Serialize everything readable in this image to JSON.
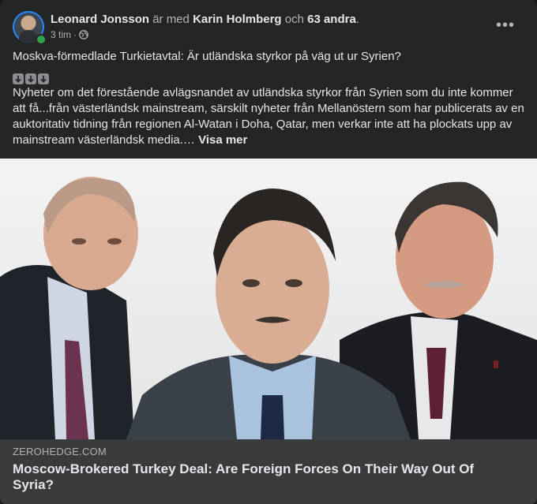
{
  "post": {
    "author": "Leonard Jonsson",
    "with_text": "är med",
    "tagged": "Karin Holmberg",
    "and_text": "och",
    "others": "63 andra",
    "period": ".",
    "time": "3 tim",
    "dot": "·",
    "audience_icon": "globe-icon",
    "more_icon": "ellipsis-icon",
    "more_label": "•••",
    "headline": "Moskva-förmedlade Turkietavtal: Är utländska styrkor på väg ut ur Syrien?",
    "arrow_icons": [
      "arrow-down-icon",
      "arrow-down-icon",
      "arrow-down-icon"
    ],
    "body": "Nyheter om det förestående avlägsnandet av utländska styrkor från Syrien som du inte kommer att få...från västerländsk mainstream, särskilt nyheter från Mellanöstern som har publicerats av en auktoritativ tidning från regionen  Al-Watan i Doha, Qatar, men verkar inte att ha plockats upp av mainstream västerländsk media.…",
    "see_more": "Visa mer"
  },
  "link_preview": {
    "domain": "ZEROHEDGE.COM",
    "title": "Moscow-Brokered Turkey Deal: Are Foreign Forces On Their Way Out Of Syria?"
  },
  "colors": {
    "card_bg": "#242526",
    "footer_bg": "#3a3b3c",
    "text_primary": "#e4e6eb",
    "text_secondary": "#b0b3b8",
    "online": "#31a24c"
  }
}
